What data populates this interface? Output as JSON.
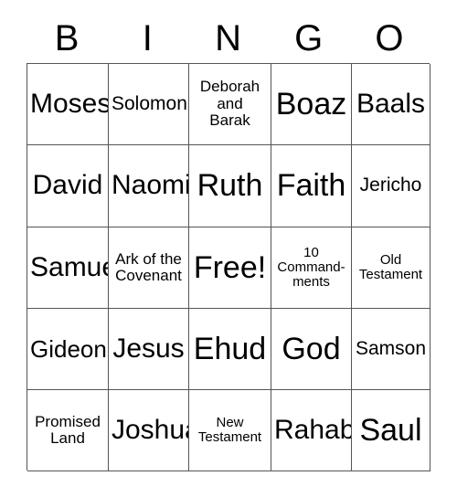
{
  "card": {
    "title": "BINGO",
    "header_letters": [
      "B",
      "I",
      "N",
      "G",
      "O"
    ],
    "columns": 5,
    "rows": 5,
    "free_space_label": "Free!",
    "free_space_position": "row3-col3",
    "colors": {
      "background": "#ffffff",
      "text": "#000000",
      "grid_line": "#555555"
    },
    "cells": [
      [
        {
          "label": "Moses",
          "size": "xl"
        },
        {
          "label": "Solomon",
          "size": "md"
        },
        {
          "label": "Deborah\nand\nBarak",
          "size": "sm"
        },
        {
          "label": "Boaz",
          "size": "xxl"
        },
        {
          "label": "Baals",
          "size": "xl"
        }
      ],
      [
        {
          "label": "David",
          "size": "xl"
        },
        {
          "label": "Naomi",
          "size": "xl"
        },
        {
          "label": "Ruth",
          "size": "xxl"
        },
        {
          "label": "Faith",
          "size": "xxl"
        },
        {
          "label": "Jericho",
          "size": "md"
        }
      ],
      [
        {
          "label": "Samuel",
          "size": "xl"
        },
        {
          "label": "Ark of the\nCovenant",
          "size": "sm"
        },
        {
          "label": "Free!",
          "size": "xxl"
        },
        {
          "label": "10\nCommand-\nments",
          "size": "xs"
        },
        {
          "label": "Old\nTestament",
          "size": "xs"
        }
      ],
      [
        {
          "label": "Gideon",
          "size": "lg"
        },
        {
          "label": "Jesus",
          "size": "xl"
        },
        {
          "label": "Ehud",
          "size": "xxl"
        },
        {
          "label": "God",
          "size": "xxl"
        },
        {
          "label": "Samson",
          "size": "md"
        }
      ],
      [
        {
          "label": "Promised\nLand",
          "size": "sm"
        },
        {
          "label": "Joshua",
          "size": "xl"
        },
        {
          "label": "New\nTestament",
          "size": "xs"
        },
        {
          "label": "Rahab",
          "size": "xl"
        },
        {
          "label": "Saul",
          "size": "xxl"
        }
      ]
    ]
  }
}
